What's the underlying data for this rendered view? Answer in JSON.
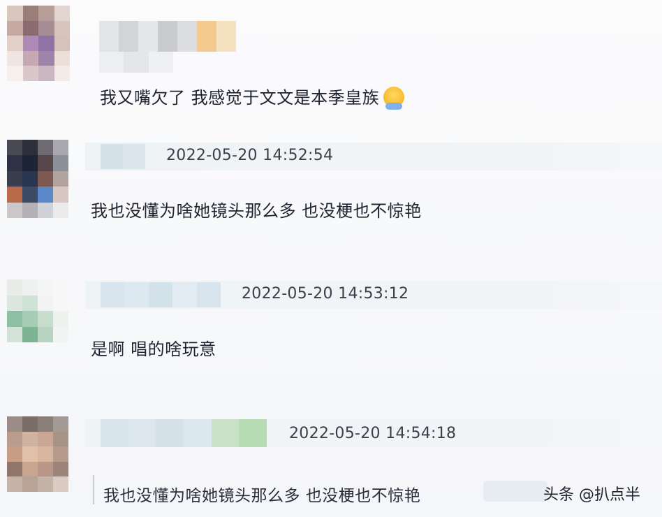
{
  "comments": [
    {
      "text": "我又嘴欠了 我感觉于文文是本季皇族",
      "emoji": "hugging-face-icon"
    },
    {
      "timestamp": "2022-05-20 14:52:54",
      "text": "我也没懂为啥她镜头那么多 也没梗也不惊艳"
    },
    {
      "timestamp": "2022-05-20 14:53:12",
      "text": "是啊 唱的啥玩意"
    },
    {
      "timestamp": "2022-05-20 14:54:18",
      "quote": "我也没懂为啥她镜头那么多 也没梗也不惊艳"
    }
  ],
  "watermark": {
    "text": "头条 @扒点半"
  }
}
